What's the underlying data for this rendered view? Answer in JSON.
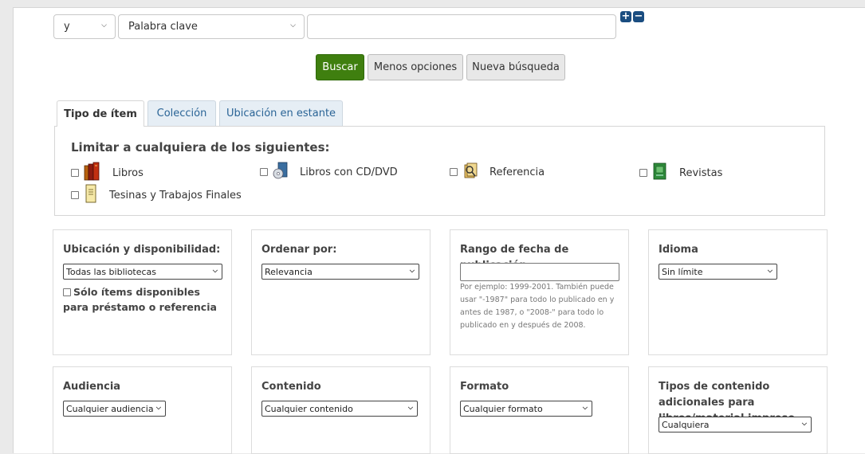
{
  "search": {
    "operator": "y",
    "index": "Palabra clave",
    "query": "",
    "buttons": {
      "search": "Buscar",
      "fewer": "Menos opciones",
      "new": "Nueva búsqueda"
    }
  },
  "tabs": [
    {
      "label": "Tipo de ítem",
      "active": true
    },
    {
      "label": "Colección",
      "active": false
    },
    {
      "label": "Ubicación en estante",
      "active": false
    }
  ],
  "itemtypes": {
    "title": "Limitar a cualquiera de los siguientes:",
    "items": [
      {
        "label": "Libros",
        "icon": "books-icon"
      },
      {
        "label": "Libros con CD/DVD",
        "icon": "cd-book-icon"
      },
      {
        "label": "Referencia",
        "icon": "reference-icon"
      },
      {
        "label": "Revistas",
        "icon": "magazine-icon"
      },
      {
        "label": "Tesinas y Trabajos Finales",
        "icon": "thesis-icon"
      }
    ]
  },
  "filters": {
    "location": {
      "title": "Ubicación y disponibilidad:",
      "value": "Todas las bibliotecas",
      "available_label": "Sólo ítems disponibles para préstamo o referencia"
    },
    "sort": {
      "title": "Ordenar por:",
      "value": "Relevancia"
    },
    "pubdate": {
      "title": "Rango de fecha de publicación",
      "value": "",
      "help": "Por ejemplo: 1999-2001. También puede usar \"-1987\" para todo lo publicado en y antes de 1987, o \"2008-\" para todo lo publicado en y después de 2008."
    },
    "language": {
      "title": "Idioma",
      "value": "Sin límite"
    },
    "audience": {
      "title": "Audiencia",
      "value": "Cualquier audiencia"
    },
    "content": {
      "title": "Contenido",
      "value": "Cualquier contenido"
    },
    "format": {
      "title": "Formato",
      "value": "Cualquier formato"
    },
    "additional": {
      "title": "Tipos de contenido adicionales para libros/material impreso",
      "value": "Cualquiera"
    }
  },
  "colors": {
    "primary": "#3f7f0f",
    "link": "#2a6496",
    "plus_minus": "#1a4d80"
  }
}
